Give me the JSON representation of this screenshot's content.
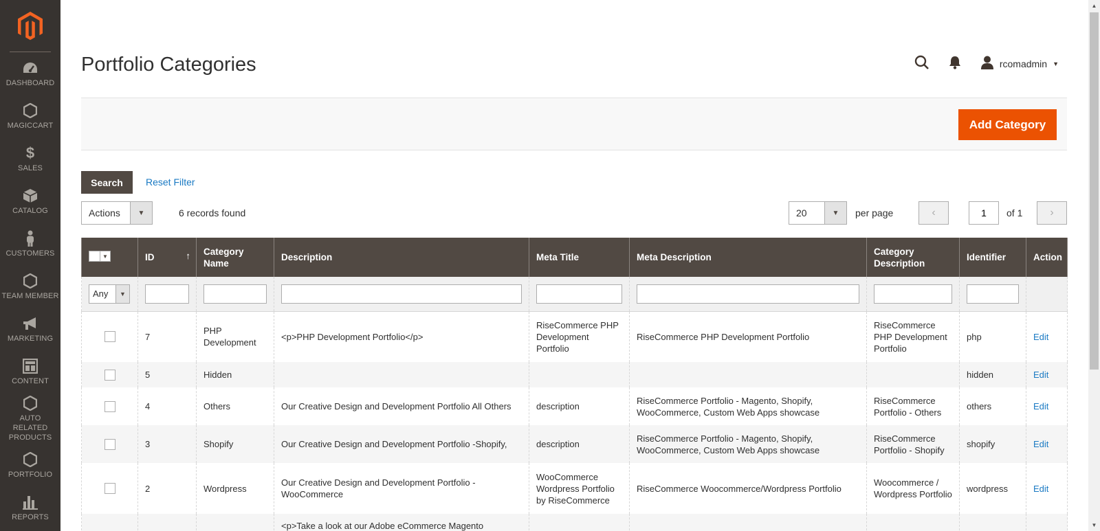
{
  "sidebar": {
    "items": [
      {
        "label": "DASHBOARD",
        "icon": "dashboard-icon"
      },
      {
        "label": "MAGICCART",
        "icon": "hexagon-icon"
      },
      {
        "label": "SALES",
        "icon": "dollar-icon"
      },
      {
        "label": "CATALOG",
        "icon": "box-icon"
      },
      {
        "label": "CUSTOMERS",
        "icon": "person-icon"
      },
      {
        "label": "TEAM MEMBER",
        "icon": "hexagon-icon"
      },
      {
        "label": "MARKETING",
        "icon": "megaphone-icon"
      },
      {
        "label": "CONTENT",
        "icon": "layout-icon"
      },
      {
        "label": "AUTO RELATED PRODUCTS",
        "icon": "hexagon-icon"
      },
      {
        "label": "PORTFOLIO",
        "icon": "hexagon-icon"
      },
      {
        "label": "REPORTS",
        "icon": "bar-chart-icon"
      }
    ]
  },
  "header": {
    "title": "Portfolio Categories",
    "username": "rcomadmin"
  },
  "toolbar": {
    "add_label": "Add Category",
    "search_label": "Search",
    "reset_label": "Reset Filter",
    "actions_label": "Actions",
    "records_found": "6 records found",
    "per_page_value": "20",
    "per_page_label": "per page",
    "current_page": "1",
    "of_pages": "of 1"
  },
  "grid": {
    "columns": [
      "ID",
      "Category Name",
      "Description",
      "Meta Title",
      "Meta Description",
      "Category Description",
      "Identifier",
      "Action"
    ],
    "id_sort_indicator": "↑",
    "any_label": "Any",
    "edit_label": "Edit",
    "rows": [
      {
        "id": "7",
        "name": "PHP Development",
        "description": "<p>PHP Development Portfolio</p>",
        "meta_title": "RiseCommerce PHP Development Portfolio",
        "meta_description": "RiseCommerce PHP Development Portfolio",
        "category_description": "RiseCommerce PHP Development Portfolio",
        "identifier": "php"
      },
      {
        "id": "5",
        "name": "Hidden",
        "description": "",
        "meta_title": "",
        "meta_description": "",
        "category_description": "",
        "identifier": "hidden"
      },
      {
        "id": "4",
        "name": "Others",
        "description": "Our Creative Design and Development Portfolio All Others",
        "meta_title": "description",
        "meta_description": "RiseCommerce Portfolio - Magento, Shopify, WooCommerce, Custom Web Apps showcase",
        "category_description": "RiseCommerce Portfolio - Others",
        "identifier": "others"
      },
      {
        "id": "3",
        "name": "Shopify",
        "description": "Our Creative Design and Development Portfolio -Shopify,",
        "meta_title": "description",
        "meta_description": "RiseCommerce Portfolio - Magento, Shopify, WooCommerce, Custom Web Apps showcase",
        "category_description": "RiseCommerce Portfolio - Shopify",
        "identifier": "shopify"
      },
      {
        "id": "2",
        "name": "Wordpress",
        "description": "Our Creative Design and Development Portfolio - WooCommerce",
        "meta_title": "WooCommerce Wordpress Portfolio by RiseCommerce",
        "meta_description": "RiseCommerce Woocommerce/Wordpress Portfolio",
        "category_description": "Woocommerce / Wordpress Portfolio",
        "identifier": "wordpress"
      },
      {
        "id": "",
        "name": "",
        "description": "<p>Take a look at our Adobe eCommerce Magento",
        "meta_title": "",
        "meta_description": "",
        "category_description": "",
        "identifier": ""
      }
    ]
  },
  "colors": {
    "sidebar_bg": "#373330",
    "header_bg": "#514943",
    "primary": "#eb5202",
    "link": "#1979c3"
  }
}
